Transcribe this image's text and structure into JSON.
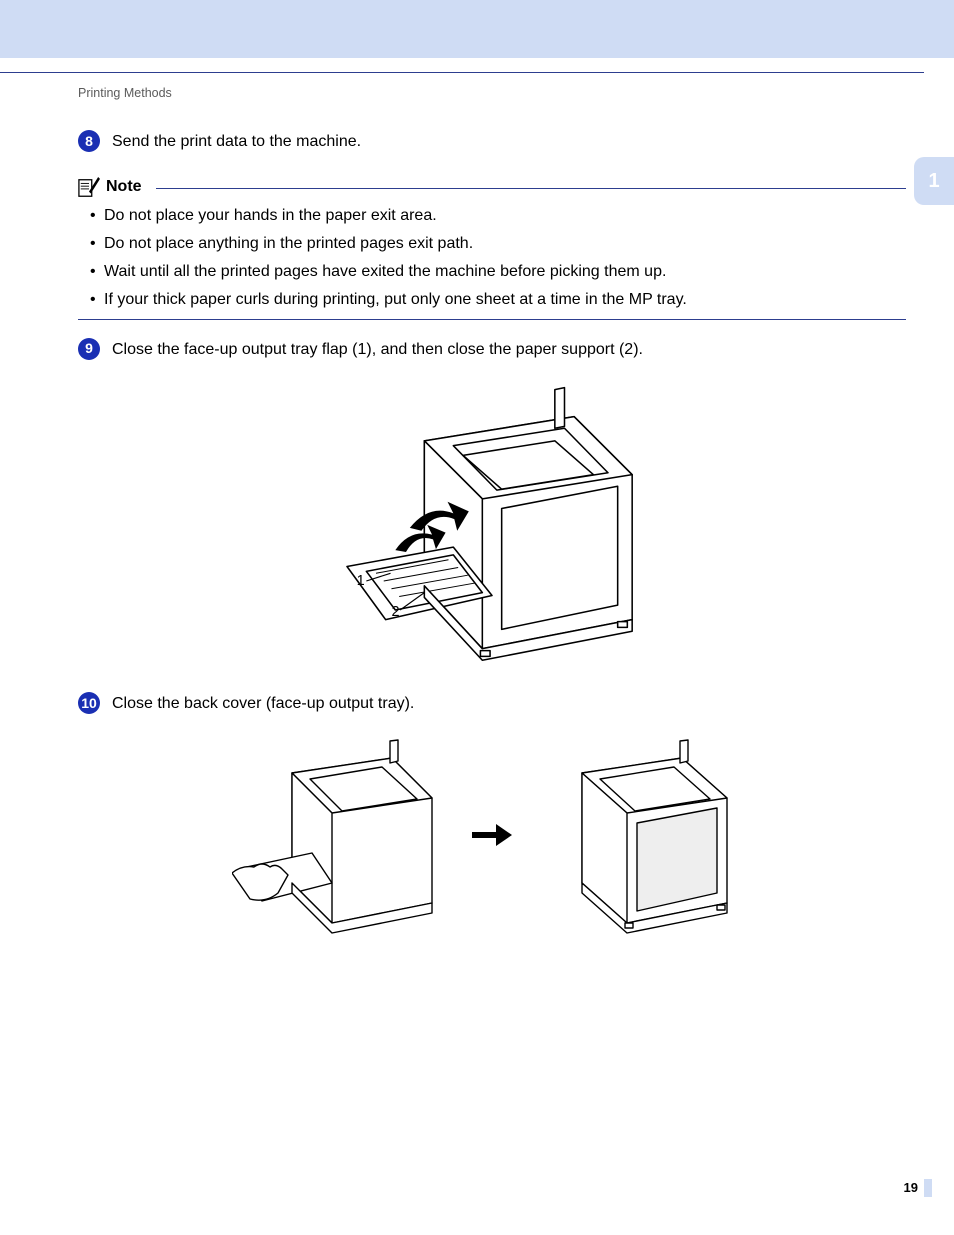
{
  "header": {
    "section": "Printing Methods"
  },
  "sidebar": {
    "chapter": "1"
  },
  "steps": {
    "s8": {
      "num": "8",
      "text": "Send the print data to the machine."
    },
    "s9": {
      "num": "9",
      "text": "Close the face-up output tray flap (1), and then close the paper support (2)."
    },
    "s10": {
      "num": "10",
      "text": "Close the back cover (face-up output tray)."
    }
  },
  "note": {
    "label": "Note",
    "items": [
      "Do not place your hands in the paper exit area.",
      "Do not place anything in the printed pages exit path.",
      "Wait until all the printed pages have exited the machine before picking them up.",
      "If your thick paper curls during printing, put only one sheet at a time in the MP tray."
    ]
  },
  "figure9": {
    "callouts": [
      "1",
      "2"
    ]
  },
  "footer": {
    "page": "19"
  }
}
